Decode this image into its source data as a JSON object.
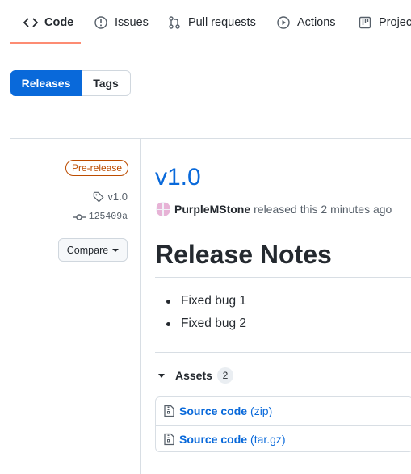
{
  "nav": {
    "tabs": [
      {
        "label": "Code",
        "icon": "code-icon",
        "active": true
      },
      {
        "label": "Issues",
        "icon": "issue-icon"
      },
      {
        "label": "Pull requests",
        "icon": "pull-request-icon"
      },
      {
        "label": "Actions",
        "icon": "play-icon"
      },
      {
        "label": "Project",
        "icon": "project-icon"
      }
    ],
    "active_color": "#fd8c73"
  },
  "switcher": {
    "releases": "Releases",
    "tags": "Tags"
  },
  "release": {
    "badge": "Pre-release",
    "tag": "v1.0",
    "commit": "125409a",
    "compare": "Compare",
    "title": "v1.0",
    "author": "PurpleMStone",
    "released_text": "released this 2 minutes ago",
    "notes_heading": "Release Notes",
    "notes": [
      "Fixed bug 1",
      "Fixed bug 2"
    ],
    "assets_label": "Assets",
    "assets_count": "2",
    "assets": [
      {
        "name": "Source code",
        "ext": "(zip)",
        "icon": "file-zip-icon"
      },
      {
        "name": "Source code",
        "ext": "(tar.gz)",
        "icon": "file-zip-icon"
      }
    ]
  },
  "colors": {
    "link": "#0969da",
    "prerelease": "#bc4c00",
    "primary": "#0969da"
  }
}
